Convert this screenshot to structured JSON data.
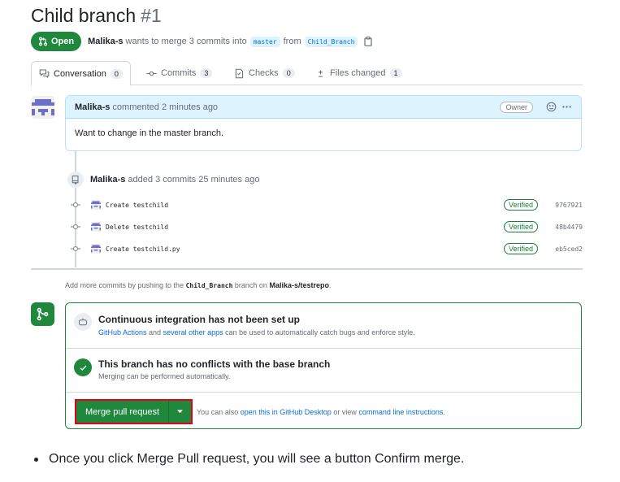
{
  "pr": {
    "title": "Child branch",
    "number": "#1",
    "state": "Open",
    "author": "Malika-s",
    "summary": "wants to merge 3 commits into",
    "base_branch": "master",
    "from_word": "from",
    "head_branch": "Child_Branch"
  },
  "tabs": [
    {
      "label": "Conversation",
      "count": "0",
      "icon": "comment-discussion-icon"
    },
    {
      "label": "Commits",
      "count": "3",
      "icon": "git-commit-icon"
    },
    {
      "label": "Checks",
      "count": "0",
      "icon": "checklist-icon"
    },
    {
      "label": "Files changed",
      "count": "1",
      "icon": "file-diff-icon"
    }
  ],
  "comment": {
    "author": "Malika-s",
    "action": "commented 2 minutes ago",
    "badge": "Owner",
    "body": "Want to change in the master branch."
  },
  "push_event": {
    "author": "Malika-s",
    "text": "added 3 commits 25 minutes ago"
  },
  "commits": [
    {
      "message": "Create testchild",
      "status": "Verified",
      "sha": "9767921"
    },
    {
      "message": "Delete testchild",
      "status": "Verified",
      "sha": "48b4479"
    },
    {
      "message": "Create testchild.py",
      "status": "Verified",
      "sha": "eb5ced2"
    }
  ],
  "push_hint": {
    "prefix": "Add more commits by pushing to the",
    "branch": "Child_Branch",
    "middle": "branch on",
    "repo": "Malika-s/testrepo",
    "suffix": "."
  },
  "merge_box": {
    "ci_title": "Continuous integration has not been set up",
    "ci_link1": "GitHub Actions",
    "ci_and": "and",
    "ci_link2": "several other apps",
    "ci_rest": "can be used to automatically catch bugs and enforce style.",
    "conflict_title": "This branch has no conflicts with the base branch",
    "conflict_desc": "Merging can be performed automatically.",
    "merge_button": "Merge pull request",
    "also_prefix": "You can also",
    "also_link1": "open this in GitHub Desktop",
    "also_mid": "or view",
    "also_link2": "command line instructions",
    "also_suffix": "."
  },
  "note": "Once you click Merge Pull request, you will see a button Confirm merge.",
  "colors": {
    "success": "#1f883d",
    "link": "#0969da",
    "highlight_border": "#e3001b",
    "comment_header": "#ddf4ff",
    "avatar": "#6e6ec8"
  }
}
